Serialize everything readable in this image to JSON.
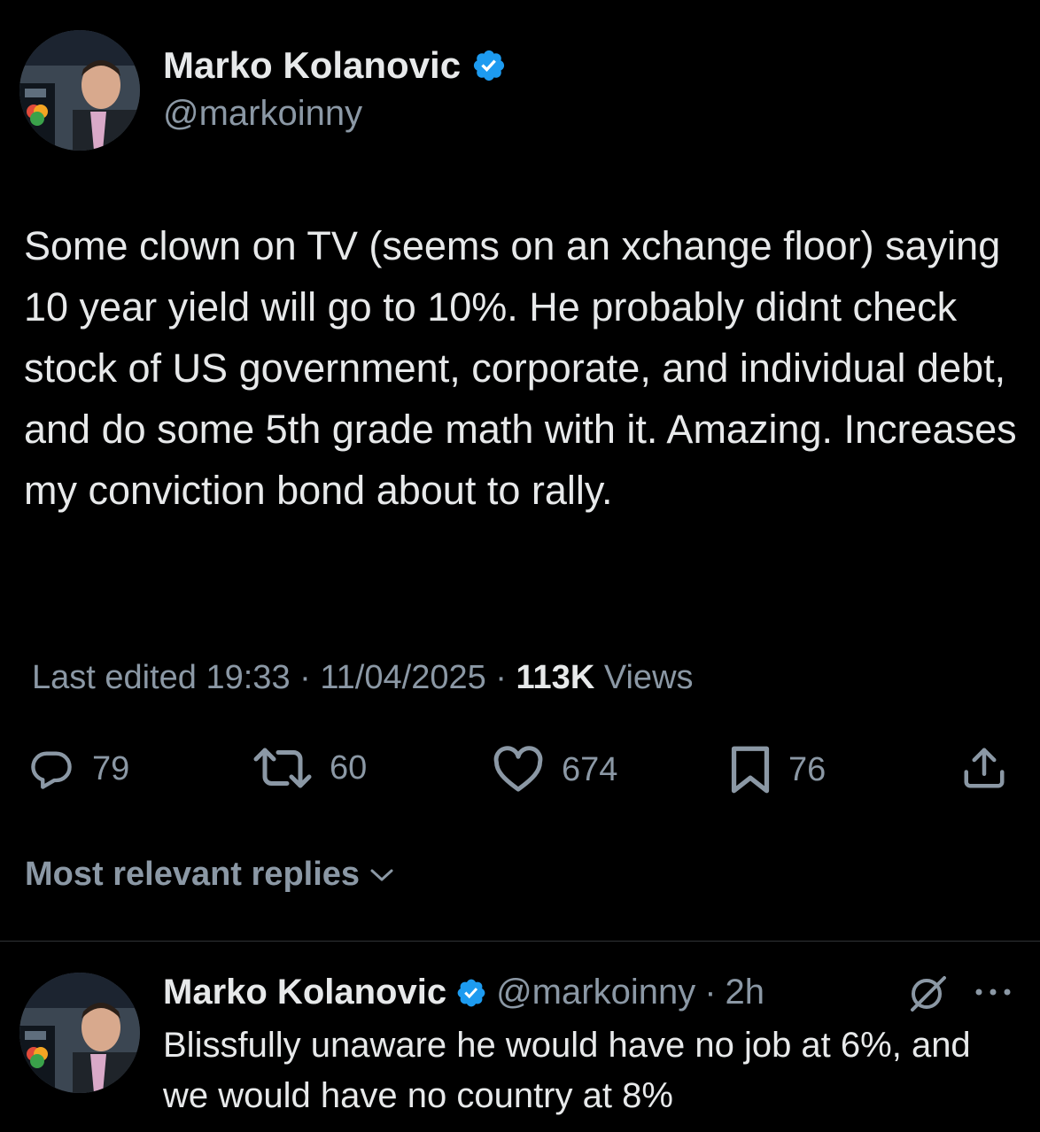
{
  "tweet": {
    "author": {
      "display_name": "Marko Kolanovic",
      "handle": "@markoinny",
      "verified": true,
      "avatar_icon": "profile-photo"
    },
    "text": "Some clown on TV (seems on an xchange floor) saying 10 year yield will go to 10%. He probably didnt check stock of US government, corporate, and individual debt, and do some 5th grade math with it. Amazing. Increases my conviction bond about to rally.",
    "edited_label": "Last edited",
    "time": "19:33",
    "date": "11/04/2025",
    "separator": "·",
    "views_count": "113K",
    "views_label": "Views",
    "actions": {
      "replies": "79",
      "reposts": "60",
      "likes": "674",
      "bookmarks": "76"
    }
  },
  "replies_filter": {
    "label": "Most relevant replies"
  },
  "reply": {
    "display_name": "Marko Kolanovic",
    "handle": "@markoinny",
    "separator": "·",
    "time": "2h",
    "text": "Blissfully unaware he would have no job at 6%, and we would have no country at 8%"
  },
  "colors": {
    "background": "#000000",
    "text_primary": "#e7e9ea",
    "text_secondary": "#8b98a5",
    "verified_blue": "#1d9bf0",
    "divider": "#2f3336"
  }
}
